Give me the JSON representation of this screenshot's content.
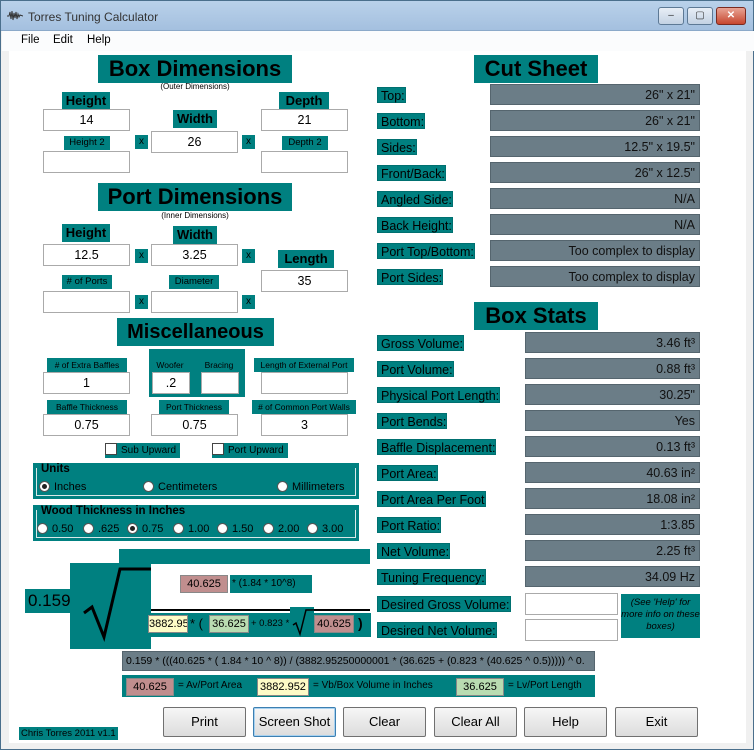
{
  "window": {
    "title": "Torres Tuning Calculator",
    "min": "–",
    "max": "▢",
    "close": "✕"
  },
  "menu": [
    "File",
    "Edit",
    "Help"
  ],
  "box_dims": {
    "title": "Box Dimensions",
    "subtitle": "(Outer Dimensions)",
    "height_label": "Height",
    "width_label": "Width",
    "depth_label": "Depth",
    "height": "14",
    "width": "26",
    "depth": "21",
    "height2_label": "Height 2",
    "depth2_label": "Depth 2",
    "height2": "",
    "depth2": "",
    "x": "x"
  },
  "port_dims": {
    "title": "Port Dimensions",
    "subtitle": "(Inner Dimensions)",
    "height_label": "Height",
    "width_label": "Width",
    "length_label": "Length",
    "height": "12.5",
    "width": "3.25",
    "length": "35",
    "ports_label": "# of Ports",
    "diameter_label": "Diameter",
    "ports": "",
    "diameter": ""
  },
  "misc": {
    "title": "Miscellaneous",
    "baffles_label": "# of Extra Baffles",
    "woofer_label": "Woofer",
    "bracing_label": "Bracing",
    "ext_port_label": "Length of External Port",
    "baffles": "1",
    "woofer": ".2",
    "bracing": "",
    "ext_port": "",
    "baffle_thick_label": "Baffle Thickness",
    "port_thick_label": "Port Thickness",
    "common_walls_label": "# of Common Port Walls",
    "baffle_thick": "0.75",
    "port_thick": "0.75",
    "common_walls": "3",
    "sub_upward": "Sub Upward",
    "port_upward": "Port Upward"
  },
  "units": {
    "title": "Units",
    "options": [
      "Inches",
      "Centimeters",
      "Millimeters"
    ],
    "selected": "Inches"
  },
  "wood": {
    "title": "Wood Thickness in Inches",
    "options": [
      "0.50",
      ".625",
      "0.75",
      "1.00",
      "1.50",
      "2.00",
      "3.00"
    ],
    "selected": "0.75"
  },
  "cut_sheet": {
    "title": "Cut Sheet",
    "rows": [
      {
        "label": "Top:",
        "value": "26\" x 21\""
      },
      {
        "label": "Bottom:",
        "value": "26\" x 21\""
      },
      {
        "label": "Sides:",
        "value": "12.5\" x 19.5\""
      },
      {
        "label": "Front/Back:",
        "value": "26\" x 12.5\""
      },
      {
        "label": "Angled Side:",
        "value": "N/A"
      },
      {
        "label": "Back Height:",
        "value": "N/A"
      },
      {
        "label": "Port Top/Bottom:",
        "value": "Too complex to display"
      },
      {
        "label": "Port Sides:",
        "value": "Too complex to display"
      }
    ]
  },
  "box_stats": {
    "title": "Box Stats",
    "rows": [
      {
        "label": "Gross Volume:",
        "value": "3.46 ft³"
      },
      {
        "label": "Port Volume:",
        "value": "0.88 ft³"
      },
      {
        "label": "Physical Port Length:",
        "value": "30.25\""
      },
      {
        "label": "Port Bends:",
        "value": "Yes"
      },
      {
        "label": "Baffle Displacement:",
        "value": "0.13 ft³"
      },
      {
        "label": "Port Area:",
        "value": "40.63 in²"
      },
      {
        "label": "Port Area Per Foot",
        "value": "18.08 in²"
      },
      {
        "label": "Port Ratio:",
        "value": "1:3.85"
      },
      {
        "label": "Net Volume:",
        "value": "2.25 ft³"
      },
      {
        "label": "Tuning Frequency:",
        "value": "34.09 Hz"
      }
    ],
    "desired_gross_label": "Desired Gross Volume:",
    "desired_net_label": "Desired Net Volume:",
    "desired_gross": "",
    "desired_net": "",
    "help_note": "(See 'Help' for more info on these boxes)"
  },
  "formula": {
    "coef": "0.159",
    "av": "40.625",
    "times_exp": "* (1.84 * 10^8)",
    "vb": "3882.952",
    "star_paren": "* (",
    "lv": "36.625",
    "plus": "+ 0.823 *",
    "av2": "40.625",
    "close": ")",
    "full": "0.159 * (((40.625 * ( 1.84 * 10 ^ 8)) / (3882.95250000001 * (36.625 + (0.823 * (40.625 ^ 0.5))))) ^ 0.",
    "legend_av": "40.625",
    "legend_av_text": "= Av/Port Area",
    "legend_vb": "3882.952",
    "legend_vb_text": "= Vb/Box Volume in Inches",
    "legend_lv": "36.625",
    "legend_lv_text": "= Lv/Port Length"
  },
  "footer": {
    "credit": "Chris Torres 2011 v1.1",
    "buttons": [
      "Print",
      "Screen Shot",
      "Clear",
      "Clear All",
      "Help",
      "Exit"
    ]
  }
}
